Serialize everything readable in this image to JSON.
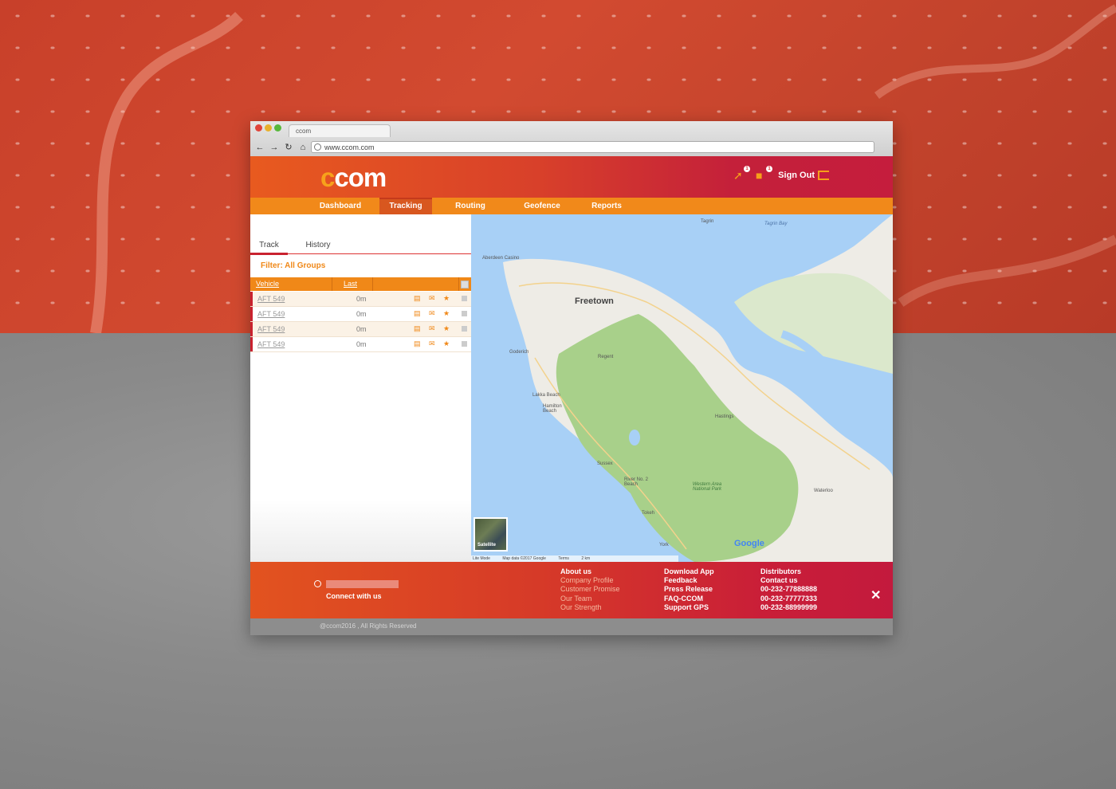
{
  "browser": {
    "tab_title": "ccom",
    "url": "www.ccom.com",
    "nav_icons": [
      "back-arrow",
      "forward-arrow",
      "reload",
      "home"
    ]
  },
  "header": {
    "logo_prefix": "c",
    "logo_rest": "com",
    "notifications": {
      "alerts_count": "1",
      "messages_count": "1"
    },
    "signout_label": "Sign Out"
  },
  "nav": {
    "items": [
      "Dashboard",
      "Tracking",
      "Routing",
      "Geofence",
      "Reports"
    ],
    "active": "Tracking"
  },
  "panel": {
    "tabs": [
      "Track",
      "History"
    ],
    "active_tab": "Track",
    "filter_label": "Filter: All Groups",
    "columns": [
      "Vehicle",
      "Last"
    ],
    "rows": [
      {
        "vehicle": "AFT 549",
        "last": "0m"
      },
      {
        "vehicle": "AFT 549",
        "last": "0m"
      },
      {
        "vehicle": "AFT 549",
        "last": "0m"
      },
      {
        "vehicle": "AFT 549",
        "last": "0m"
      }
    ]
  },
  "map": {
    "city": "Freetown",
    "labels": [
      "Tagrin",
      "Tagrin Bay",
      "Aberdeen Casino",
      "Goderich",
      "Regent",
      "Lakka Beach",
      "Hamilton Beach",
      "Hastings",
      "Sussex",
      "River No. 2 Beach",
      "Tokeh",
      "York",
      "Waterloo"
    ],
    "park_label": "Western Area National Park",
    "satellite_label": "Satellite",
    "attribution": [
      "Lite Mode",
      "Map data ©2017 Google",
      "Terms",
      "2 km"
    ],
    "brand": "Google"
  },
  "footer": {
    "connect_label": "Connect with us",
    "col1": [
      "About us",
      "Company Profile",
      "Customer Promise",
      "Our Team",
      "Our Strength"
    ],
    "col2": [
      "Download App",
      "Feedback",
      "Press Release",
      "FAQ-CCOM",
      "Support GPS"
    ],
    "col3": [
      "Distributors",
      "Contact us",
      "00-232-77888888",
      "00-232-77777333",
      "00-232-88999999"
    ],
    "copyright": "@ccom2016 , All Rights Reserved"
  },
  "colors": {
    "accent_orange": "#f08818",
    "brand_red": "#c9222f",
    "header_gradient_start": "#e85a1f",
    "header_gradient_end": "#c51d3d"
  }
}
